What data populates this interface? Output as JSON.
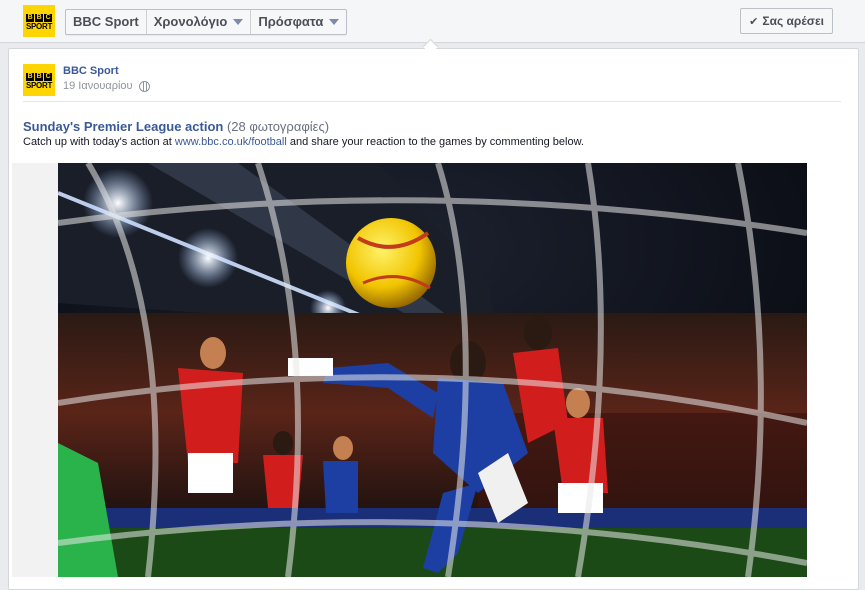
{
  "topbar": {
    "logo": {
      "line1": [
        "B",
        "B",
        "C"
      ],
      "line2": "SPORT"
    },
    "nav": [
      {
        "label": "BBC Sport",
        "dropdown": false
      },
      {
        "label": "Χρονολόγιο",
        "dropdown": true
      },
      {
        "label": "Πρόσφατα",
        "dropdown": true
      }
    ],
    "like_button": {
      "icon": "check-icon",
      "label": "Σας αρέσει"
    }
  },
  "post": {
    "page_name": "BBC Sport",
    "date": "19 Ιανουαρίου",
    "privacy_icon": "globe-icon",
    "album_title": "Sunday's Premier League action",
    "album_count": "(28 φωτογραφίες)",
    "caption_before": "Catch up with today's action at ",
    "caption_link": "www.bbc.co.uk/football",
    "caption_after": " and share your reaction to the games by commenting below.",
    "photo_description_icon": "football-photo"
  },
  "colors": {
    "brand_yellow": "#ffd500",
    "link_blue": "#3b5998",
    "chelsea_blue": "#1d3fa3",
    "united_red": "#d21d1d"
  }
}
